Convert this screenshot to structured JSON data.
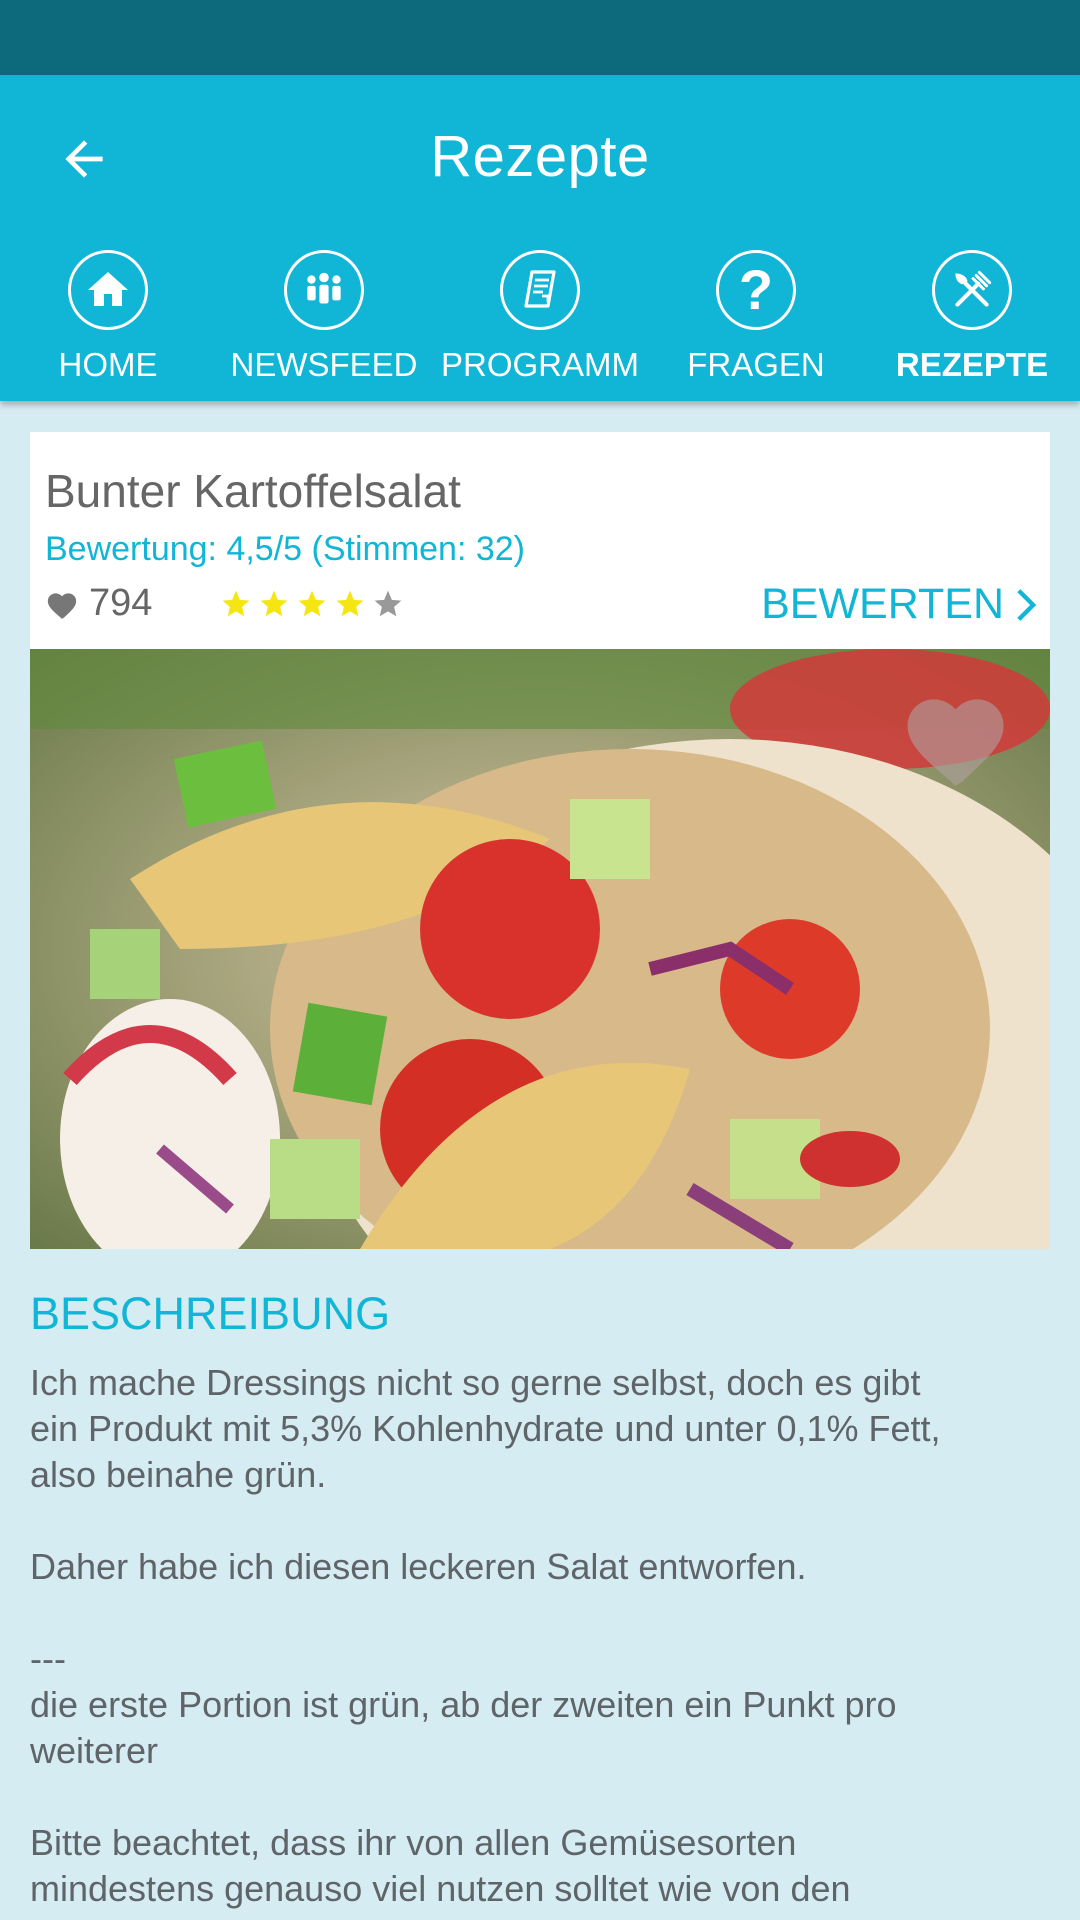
{
  "header": {
    "title": "Rezepte",
    "back_icon": "arrow-left-icon",
    "color": "#11b5d6",
    "status_bar_color": "#0d6a7d"
  },
  "nav": {
    "tabs": [
      {
        "label": "HOME",
        "icon": "home-icon",
        "active": false
      },
      {
        "label": "NEWSFEED",
        "icon": "people-icon",
        "active": false
      },
      {
        "label": "PROGRAMM",
        "icon": "document-icon",
        "active": false
      },
      {
        "label": "FRAGEN",
        "icon": "question-icon",
        "active": false
      },
      {
        "label": "REZEPTE",
        "icon": "fork-knife-icon",
        "active": true
      }
    ]
  },
  "recipe": {
    "title": "Bunter Kartoffelsalat",
    "rating_text": "Bewertung: 4,5/5 (Stimmen: 32)",
    "likes": "794",
    "stars_filled": 4,
    "stars_total": 5,
    "star_color": "#f5e613",
    "rate_label": "BEWERTEN",
    "image": "potato-salad-photo"
  },
  "description": {
    "heading": "BESCHREIBUNG",
    "lines": [
      "Ich mache Dressings nicht so gerne selbst, doch es gibt",
      "ein Produkt mit 5,3% Kohlenhydrate und unter 0,1% Fett,",
      "also beinahe grün.",
      "",
      "Daher habe ich diesen leckeren Salat entworfen.",
      "",
      "---",
      "die erste Portion ist grün, ab der zweiten ein Punkt pro",
      "weiterer",
      "",
      "Bitte beachtet, dass ihr von allen Gemüsesorten",
      "mindestens genauso viel nutzen solltet wie von den"
    ]
  }
}
